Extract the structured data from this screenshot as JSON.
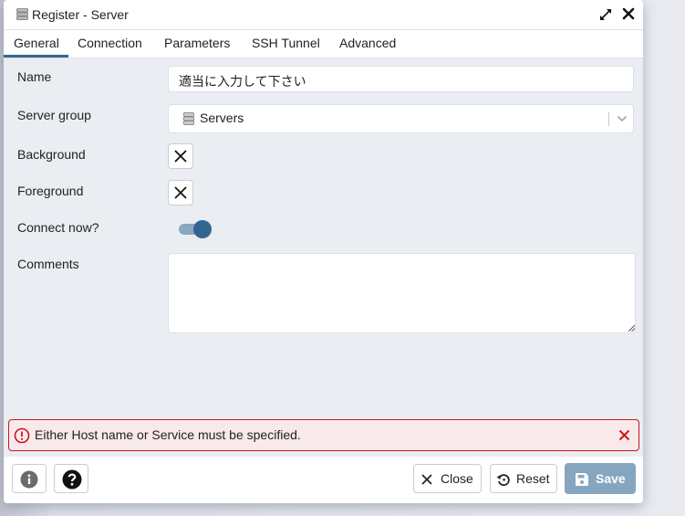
{
  "dialog": {
    "title": "Register - Server",
    "title_icon": "server-icon",
    "controls": {
      "expand_icon": "expand-icon",
      "close_icon": "close-icon"
    }
  },
  "tabs": [
    {
      "label": "General",
      "active": true
    },
    {
      "label": "Connection",
      "active": false
    },
    {
      "label": "Parameters",
      "active": false
    },
    {
      "label": "SSH Tunnel",
      "active": false
    },
    {
      "label": "Advanced",
      "active": false
    }
  ],
  "form": {
    "name": {
      "label": "Name",
      "value": "適当に入力して下さい"
    },
    "server_group": {
      "label": "Server group",
      "value": "Servers",
      "icon": "server-group-icon"
    },
    "background": {
      "label": "Background",
      "value": "none"
    },
    "foreground": {
      "label": "Foreground",
      "value": "none"
    },
    "connect_now": {
      "label": "Connect now?",
      "value": true
    },
    "comments": {
      "label": "Comments",
      "value": ""
    }
  },
  "alert": {
    "message": "Either Host name or Service must be specified.",
    "type": "error",
    "color": "#c8161d"
  },
  "footer": {
    "info_icon": "info-icon",
    "help_icon": "help-icon",
    "close_label": "Close",
    "reset_label": "Reset",
    "save_label": "Save"
  },
  "colors": {
    "accent": "#326690",
    "save_disabled": "#86a5bf",
    "error": "#c8161d",
    "error_bg": "#fae9ea"
  }
}
